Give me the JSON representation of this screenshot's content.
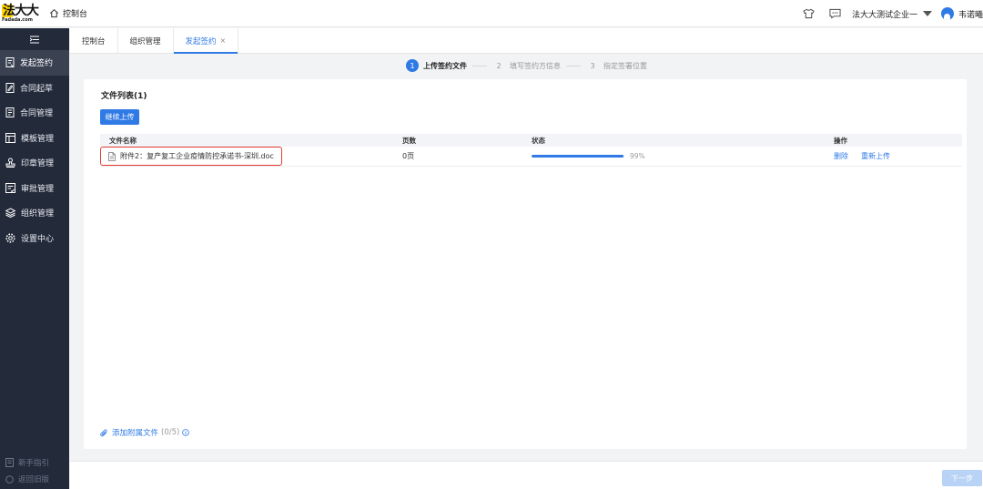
{
  "header": {
    "logo_text": "法大大",
    "logo_domain": "Fadada.com",
    "home_label": "控制台",
    "company": "法大大测试企业一",
    "user_name": "韦诺曦"
  },
  "sidebar": {
    "items": [
      {
        "label": "发起签约",
        "icon": "send-icon",
        "active": true
      },
      {
        "label": "合同起草",
        "icon": "draft-icon"
      },
      {
        "label": "合同管理",
        "icon": "contract-icon"
      },
      {
        "label": "模板管理",
        "icon": "template-icon"
      },
      {
        "label": "印章管理",
        "icon": "seal-icon"
      },
      {
        "label": "审批管理",
        "icon": "approval-icon"
      },
      {
        "label": "组织管理",
        "icon": "layers-icon"
      },
      {
        "label": "设置中心",
        "icon": "gear-icon"
      }
    ],
    "bottom": [
      {
        "label": "新手指引",
        "icon": "guide-icon"
      },
      {
        "label": "返回旧版",
        "icon": "return-icon"
      }
    ]
  },
  "tabs": [
    {
      "label": "控制台"
    },
    {
      "label": "组织管理"
    },
    {
      "label": "发起签约",
      "active": true,
      "closable": "×"
    }
  ],
  "steps": [
    {
      "num": "1",
      "label": "上传签约文件",
      "active": true
    },
    {
      "num": "2",
      "label": "填写签约方信息"
    },
    {
      "num": "3",
      "label": "指定签署位置"
    }
  ],
  "file_list": {
    "title": "文件列表(1)",
    "upload_button": "继续上传",
    "columns": [
      "文件名称",
      "页数",
      "状态",
      "操作"
    ],
    "rows": [
      {
        "name": "附件2：复产复工企业疫情防控承诺书-深圳.doc",
        "pages": "0页",
        "progress": 0.99,
        "progress_label": "99%",
        "actions": [
          "删除",
          "重新上传"
        ]
      }
    ]
  },
  "attachment": {
    "label": "添加附属文件",
    "count": "(0/5)"
  },
  "footer": {
    "next_button": "下一步"
  },
  "colors": {
    "primary": "#2f7ae5",
    "sidebar_bg": "#232a3a",
    "highlight_border": "#e23b32"
  }
}
